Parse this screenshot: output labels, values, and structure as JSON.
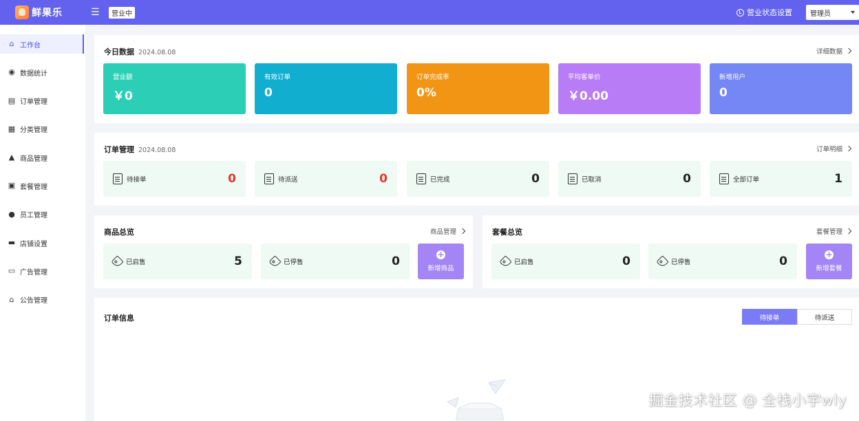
{
  "header": {
    "app_name": "鲜果乐",
    "status": "营业中",
    "status_setting": "营业状态设置",
    "user": "管理员",
    "bg_color": "#6362ee"
  },
  "sidebar": {
    "items": [
      {
        "label": "工作台",
        "icon": "home-icon"
      },
      {
        "label": "数据统计",
        "icon": "chart-icon"
      },
      {
        "label": "订单管理",
        "icon": "clipboard-icon"
      },
      {
        "label": "分类管理",
        "icon": "grid-icon"
      },
      {
        "label": "商品管理",
        "icon": "dish-icon"
      },
      {
        "label": "套餐管理",
        "icon": "gift-icon"
      },
      {
        "label": "员工管理",
        "icon": "info-icon"
      },
      {
        "label": "店铺设置",
        "icon": "store-icon"
      },
      {
        "label": "广告管理",
        "icon": "billboard-icon"
      },
      {
        "label": "公告管理",
        "icon": "warehouse-icon"
      }
    ]
  },
  "today": {
    "title": "今日数据",
    "date": "2024.08.08",
    "link": "详细数据",
    "stats": [
      {
        "label": "营业额",
        "value": "￥0",
        "color": "#2ccfb6"
      },
      {
        "label": "有效订单",
        "value": "0",
        "color": "#12aecf"
      },
      {
        "label": "订单完成率",
        "value": "0%",
        "color": "#f29514"
      },
      {
        "label": "平均客单价",
        "value": "￥0.00",
        "color": "#b97cf7"
      },
      {
        "label": "新增用户",
        "value": "0",
        "color": "#7586f5"
      }
    ]
  },
  "orders": {
    "title": "订单管理",
    "date": "2024.08.08",
    "link": "订单明细",
    "items": [
      {
        "label": "待接单",
        "count": "0"
      },
      {
        "label": "待派送",
        "count": "0"
      },
      {
        "label": "已完成",
        "count": "0"
      },
      {
        "label": "已取消",
        "count": "0"
      },
      {
        "label": "全部订单",
        "count": "1"
      }
    ]
  },
  "products": {
    "title": "商品总览",
    "link": "商品管理",
    "on_label": "已启售",
    "on_count": "5",
    "off_label": "已停售",
    "off_count": "0",
    "add_label": "新增商品"
  },
  "combos": {
    "title": "套餐总览",
    "link": "套餐管理",
    "on_label": "已启售",
    "on_count": "0",
    "off_label": "已停售",
    "off_count": "0",
    "add_label": "新增套餐"
  },
  "order_info": {
    "title": "订单信息",
    "tabs": [
      "待接单",
      "待派送"
    ]
  },
  "watermark": "掘金技术社区 @ 全栈小宇wly"
}
